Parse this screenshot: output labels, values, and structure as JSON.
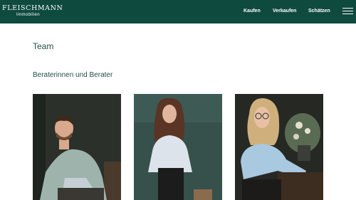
{
  "header": {
    "logo_main": "FLEISCHMANN",
    "logo_sub": "Immobilien",
    "nav": [
      {
        "label": "Kaufen"
      },
      {
        "label": "Verkaufen"
      },
      {
        "label": "Schätzen"
      }
    ],
    "menu_icon": "hamburger-menu-icon",
    "background_color": "#0f4a3f"
  },
  "main": {
    "title": "Team",
    "section_title": "Beraterinnen und Berater",
    "accent_color": "#1f4f46",
    "advisors": [
      {
        "photo": "advisor-photo-man-light-shirt"
      },
      {
        "photo": "advisor-photo-woman-dark-hair"
      },
      {
        "photo": "advisor-photo-woman-blonde-glasses"
      }
    ]
  }
}
